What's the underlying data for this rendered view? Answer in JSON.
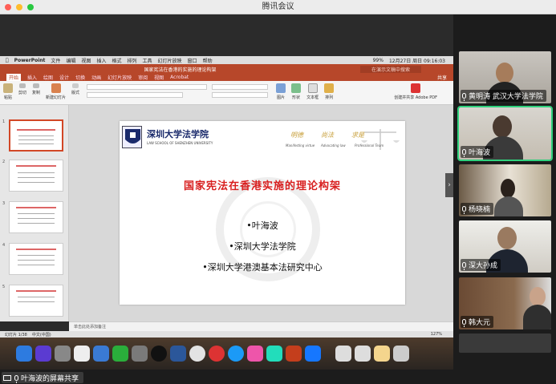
{
  "window": {
    "title": "腾讯会议"
  },
  "mac_menu": {
    "items": [
      "PowerPoint",
      "文件",
      "编辑",
      "视图",
      "插入",
      "格式",
      "排列",
      "工具",
      "幻灯片放映",
      "窗口",
      "帮助"
    ],
    "clock": "12月27日 周日 09:16:03",
    "battery": "99%"
  },
  "ppt": {
    "doc_title": "国家宪法在香港的实施的理论构架",
    "search_placeholder": "在演示文稿中搜索",
    "share": "共享",
    "tabs": [
      "开始",
      "插入",
      "绘图",
      "设计",
      "切换",
      "动画",
      "幻灯片放映",
      "审阅",
      "视图",
      "Acrobat"
    ],
    "active_tab": "开始",
    "ribbon": [
      "粘贴",
      "剪切",
      "复制",
      "格式",
      "新建幻灯片",
      "版式",
      "重置",
      "节",
      "形状",
      "排列",
      "文本框",
      "图片",
      "创建并共享 Adobe PDF"
    ],
    "notes": "单击此处添加备注",
    "status": "幻灯片 1/38",
    "lang": "中文(中国)",
    "zoom": "127%"
  },
  "slide": {
    "school_cn": "深圳大学法学院",
    "school_en": "LAW SCHOOL OF SHENZHEN UNIVERSITY",
    "motto_cn": [
      "明德",
      "尚法",
      "求是"
    ],
    "motto_en": [
      "Manifesting virtue",
      "Advocating law",
      "Professional Team"
    ],
    "headline": "国家宪法在香港实施的理论构架",
    "bullets": [
      "•叶海波",
      "•深圳大学法学院",
      "•深圳大学港澳基本法研究中心"
    ]
  },
  "participants": [
    {
      "name": "黄明涛 武汉大学法学院"
    },
    {
      "name": "叶海波",
      "active": true
    },
    {
      "name": "杨晓楠"
    },
    {
      "name": "深大孙成"
    },
    {
      "name": "韩大元"
    }
  ],
  "share_label": "叶海波的屏幕共享",
  "colors": {
    "ppt_brand": "#b7472a",
    "headline_red": "#d81e1e",
    "active_speaker": "#2fd17d"
  }
}
